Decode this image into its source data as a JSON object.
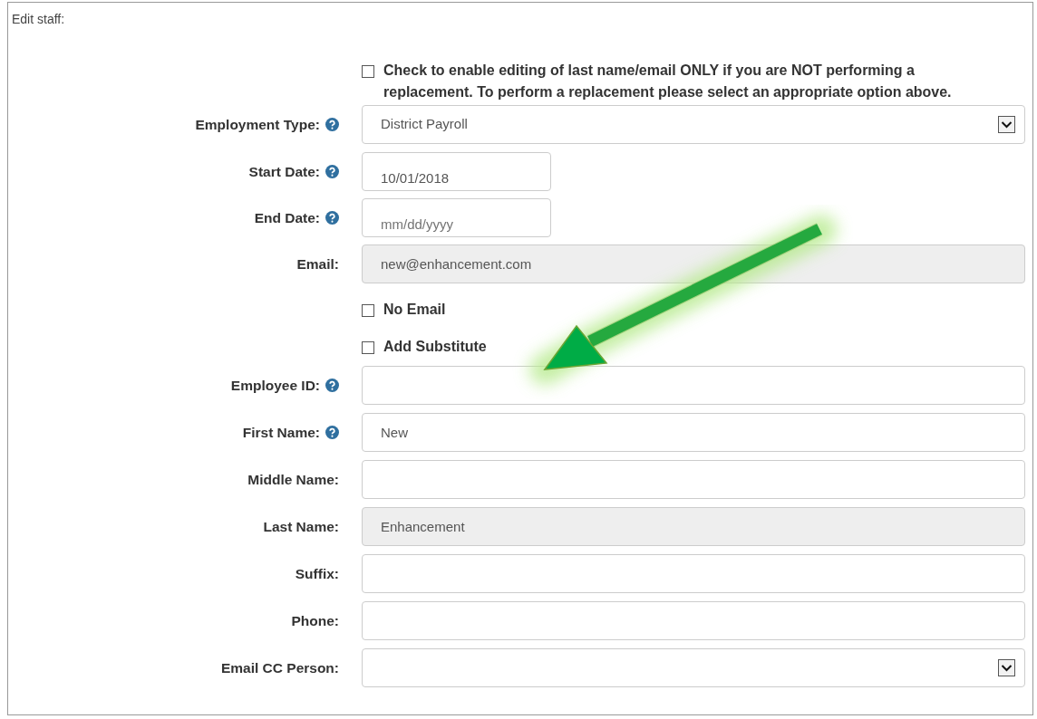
{
  "title": "Edit staff:",
  "fields": [
    {
      "kind": "checkbox",
      "label": "Check to enable editing of last name/email ONLY if you are NOT performing a replacement. To perform a replacement please select an appropriate option above.",
      "checked": false
    },
    {
      "kind": "select",
      "label": "Employment Type:",
      "help": true,
      "value": "District Payroll"
    },
    {
      "kind": "date",
      "label": "Start Date:",
      "help": true,
      "value": "10/01/2018",
      "disabled": false
    },
    {
      "kind": "date",
      "label": "End Date:",
      "help": true,
      "placeholder": "mm/dd/yyyy",
      "disabled": false
    },
    {
      "kind": "text",
      "label": "Email:",
      "value": "new@enhancement.com",
      "disabled": true
    },
    {
      "kind": "checkbox",
      "label": "No Email",
      "checked": false
    },
    {
      "kind": "checkbox",
      "label": "Add Substitute",
      "checked": false
    },
    {
      "kind": "text",
      "label": "Employee ID:",
      "help": true,
      "disabled": false
    },
    {
      "kind": "text",
      "label": "First Name:",
      "help": true,
      "value": "New",
      "disabled": false
    },
    {
      "kind": "text",
      "label": "Middle Name:",
      "disabled": false
    },
    {
      "kind": "text",
      "label": "Last Name:",
      "value": "Enhancement",
      "disabled": true
    },
    {
      "kind": "text",
      "label": "Suffix:",
      "disabled": false
    },
    {
      "kind": "text",
      "label": "Phone:",
      "disabled": false
    },
    {
      "kind": "select",
      "label": "Email CC Person:"
    }
  ]
}
